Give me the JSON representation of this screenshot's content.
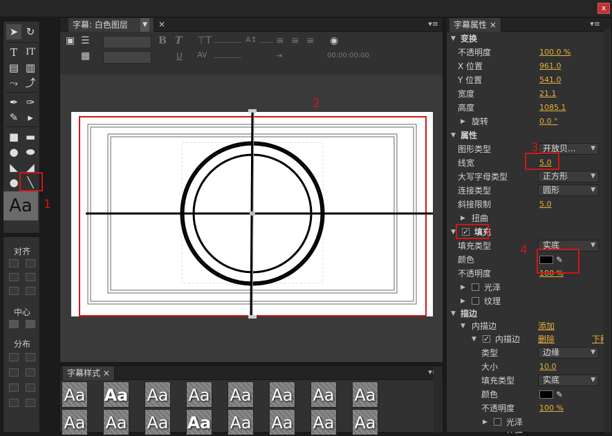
{
  "window": {
    "close": "x"
  },
  "tools": {
    "text_tool": "T",
    "vtext_tool": "IT",
    "aa_preview": "Aa"
  },
  "align": {
    "align_label": "对齐",
    "center_label": "中心",
    "distribute_label": "分布"
  },
  "title_panel": {
    "tab": "字幕: 白色图层",
    "close": "×",
    "menu": "▾≡",
    "timecode": "00:00:00:00"
  },
  "styles_panel": {
    "tab": "字幕样式",
    "close": "×",
    "menu": "▾≡",
    "samples": [
      "Aa",
      "Aa",
      "Aa",
      "Aa",
      "Aa",
      "Aa",
      "Aa",
      "Aa",
      "Aa",
      "Aa",
      "Aa",
      "Aa",
      "Aa",
      "Aa",
      "Aa",
      "Aa"
    ]
  },
  "props": {
    "tab": "字幕属性",
    "close": "×",
    "menu": "▾≡",
    "transform": "变换",
    "opacity_l": "不透明度",
    "opacity_v": "100.0 %",
    "xpos_l": "X 位置",
    "xpos_v": "961.0",
    "ypos_l": "Y 位置",
    "ypos_v": "541.0",
    "width_l": "宽度",
    "width_v": "21.1",
    "height_l": "高度",
    "height_v": "1085.1",
    "rot_l": "旋转",
    "rot_v": "0.0 °",
    "attrs": "属性",
    "shape_l": "图形类型",
    "shape_v": "开放贝...",
    "linew_l": "线宽",
    "linew_v": "5.0",
    "cap_l": "大写字母类型",
    "cap_v": "正方形",
    "join_l": "连接类型",
    "join_v": "圆形",
    "miter_l": "斜接限制",
    "miter_v": "5.0",
    "distort_l": "扭曲",
    "fill": "填充",
    "filltype_l": "填充类型",
    "filltype_v": "实底",
    "color_l": "颜色",
    "fopacity_l": "不透明度",
    "fopacity_v": "100 %",
    "sheen_l": "光泽",
    "texture_l": "纹理",
    "stroke": "描边",
    "inner_l": "内描边",
    "inner_add": "添加",
    "inner2_l": "内描边",
    "inner_del": "删除",
    "inner_down": "下移",
    "type_l": "类型",
    "type_v": "边缘",
    "size_l": "大小",
    "size_v": "10.0",
    "sfill_l": "填充类型",
    "sfill_v": "实底",
    "scolor_l": "颜色",
    "sopacity_l": "不透明度",
    "sopacity_v": "100 %",
    "ssheen_l": "光泽",
    "stexture_l": "纹理"
  },
  "annotations": {
    "n1": "1",
    "n2": "2",
    "n3": "3",
    "n4": "4"
  },
  "colors": {
    "accent": "#e8b339",
    "annotation": "#d21616",
    "panel": "#313131"
  }
}
